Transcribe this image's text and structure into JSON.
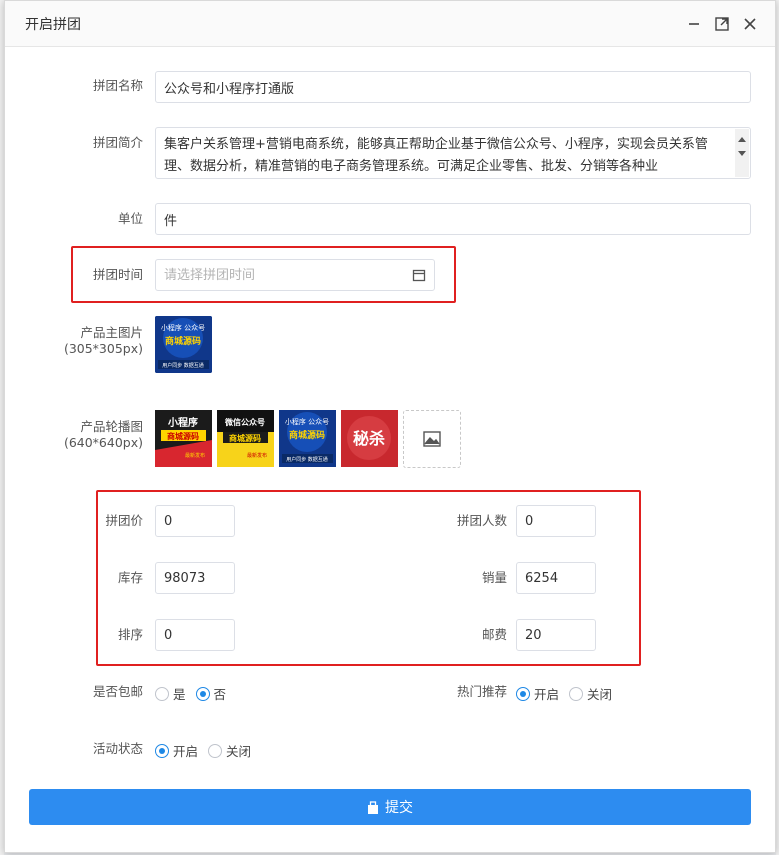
{
  "dialog": {
    "title": "开启拼团"
  },
  "form": {
    "name_label": "拼团名称",
    "name_value": "公众号和小程序打通版",
    "intro_label": "拼团简介",
    "intro_value": "集客户关系管理+营销电商系统，能够真正帮助企业基于微信公众号、小程序，实现会员关系管理、数据分析，精准营销的电子商务管理系统。可满足企业零售、批发、分销等各种业",
    "unit_label": "单位",
    "unit_value": "件",
    "time_label": "拼团时间",
    "time_placeholder": "请选择拼团时间",
    "main_image_label": "产品主图片",
    "main_image_size": "(305*305px)",
    "carousel_label": "产品轮播图",
    "carousel_size": "(640*640px)",
    "price_label": "拼团价",
    "price_value": "0",
    "people_label": "拼团人数",
    "people_value": "0",
    "stock_label": "库存",
    "stock_value": "98073",
    "sales_label": "销量",
    "sales_value": "6254",
    "sort_label": "排序",
    "sort_value": "0",
    "postage_label": "邮费",
    "postage_value": "20",
    "free_ship_label": "是否包邮",
    "free_ship_options": [
      "是",
      "否"
    ],
    "free_ship_selected": "否",
    "hot_label": "热门推荐",
    "hot_options": [
      "开启",
      "关闭"
    ],
    "hot_selected": "开启",
    "status_label": "活动状态",
    "status_options": [
      "开启",
      "关闭"
    ],
    "status_selected": "开启",
    "submit_label": "提交"
  },
  "thumbnails": {
    "main": {
      "line1": "小程序 公众号",
      "line2": "商城源码",
      "line3": "用户同步 数据互通"
    },
    "carousel": [
      {
        "line1": "小程序",
        "line2": "商城源码",
        "line3": "最新发布"
      },
      {
        "line1": "微信公众号",
        "line2": "商城源码",
        "line3": "最新发布"
      },
      {
        "line1": "小程序 公众号",
        "line2": "商城源码",
        "line3": "用户同步 数据互通"
      },
      {
        "line1": "秘杀",
        "line2": "",
        "line3": ""
      }
    ]
  },
  "colors": {
    "primary": "#2d8cf0",
    "highlight_box": "#e02020"
  }
}
